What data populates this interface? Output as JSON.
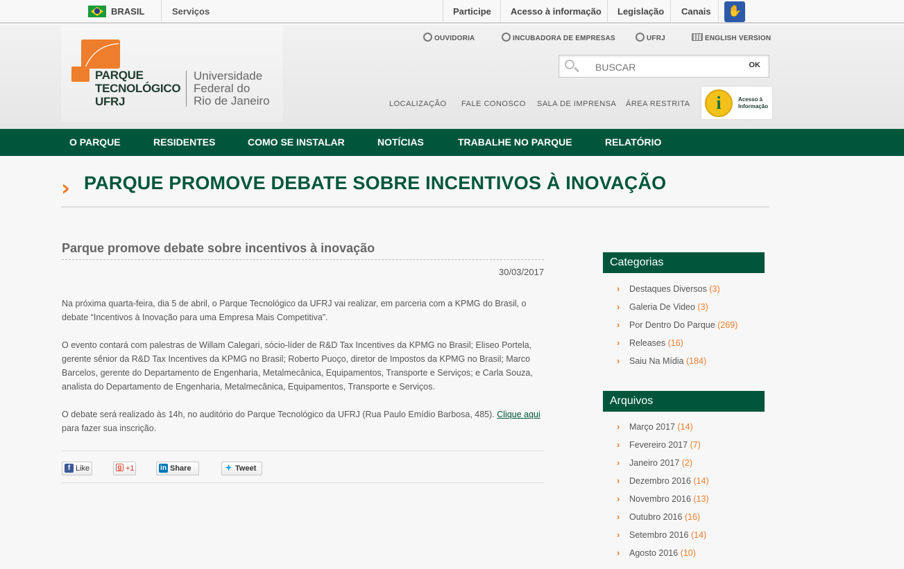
{
  "gov_bar": {
    "country": "BRASIL",
    "services": "Serviços",
    "links": [
      "Participe",
      "Acesso à informação",
      "Legislação",
      "Canais"
    ]
  },
  "logo": {
    "line1": "PARQUE",
    "line2": "TECNOLÓGICO",
    "line3": "UFRJ",
    "univ1": "Universidade",
    "univ2": "Federal do",
    "univ3": "Rio de Janeiro"
  },
  "header_links": [
    "OUVIDORIA",
    "INCUBADORA DE EMPRESAS",
    "UFRJ",
    "ENGLISH VERSION"
  ],
  "search": {
    "placeholder": "BUSCAR",
    "button": "OK"
  },
  "sub_links": [
    "LOCALIZAÇÃO",
    "FALE CONOSCO",
    "SALA DE IMPRENSA",
    "ÁREA RESTRITA"
  ],
  "acesso_badge": {
    "line1": "Acesso à",
    "line2": "Informação"
  },
  "nav": [
    "O PARQUE",
    "RESIDENTES",
    "COMO SE INSTALAR",
    "NOTÍCIAS",
    "TRABALHE NO PARQUE",
    "RELATÓRIO"
  ],
  "page_title": "PARQUE PROMOVE DEBATE SOBRE INCENTIVOS À INOVAÇÃO",
  "article": {
    "title": "Parque promove debate sobre incentivos à inovação",
    "date": "30/03/2017",
    "p1": "Na próxima quarta-feira, dia 5 de abril, o Parque Tecnológico da UFRJ vai realizar, em parceria com a KPMG do Brasil, o debate “Incentivos à Inovação para uma Empresa Mais Competitiva”.",
    "p2": "O evento contará com palestras de Willam Calegari, sócio-líder de R&D Tax Incentives da KPMG no Brasil; Eliseo Portela, gerente sênior da R&D Tax Incentives da KPMG no Brasil; Roberto Puoço, diretor de Impostos da KPMG no Brasil; Marco Barcelos, gerente do Departamento de Engenharia, Metalmecânica, Equipamentos, Transporte e Serviços; e Carla Souza, analista do Departamento de Engenharia, Metalmecânica, Equipamentos, Transporte e Serviços.",
    "p3_before": "O debate será realizado às 14h, no auditório do Parque Tecnológico da UFRJ (Rua Paulo Emídio Barbosa, 485). ",
    "p3_link": "Clique aqui",
    "p3_after": " para fazer sua inscrição."
  },
  "share": {
    "facebook": "Like",
    "gplus": "+1",
    "linkedin": "Share",
    "twitter": "Tweet"
  },
  "sidebar": {
    "categories_title": "Categorias",
    "categories": [
      {
        "label": "Destaques Diversos",
        "count": "(3)"
      },
      {
        "label": "Galeria De Video",
        "count": "(3)"
      },
      {
        "label": "Por Dentro Do Parque",
        "count": "(269)"
      },
      {
        "label": "Releases",
        "count": "(16)"
      },
      {
        "label": "Saiu Na Mídia",
        "count": "(184)"
      }
    ],
    "archives_title": "Arquivos",
    "archives": [
      {
        "label": "Março 2017",
        "count": "(14)"
      },
      {
        "label": "Fevereiro 2017",
        "count": "(7)"
      },
      {
        "label": "Janeiro 2017",
        "count": "(2)"
      },
      {
        "label": "Dezembro 2016",
        "count": "(14)"
      },
      {
        "label": "Novembro 2016",
        "count": "(13)"
      },
      {
        "label": "Outubro 2016",
        "count": "(16)"
      },
      {
        "label": "Setembro 2016",
        "count": "(14)"
      },
      {
        "label": "Agosto 2016",
        "count": "(10)"
      }
    ]
  },
  "colors": {
    "brand_green": "#00563b",
    "brand_orange": "#ee7d2c"
  }
}
